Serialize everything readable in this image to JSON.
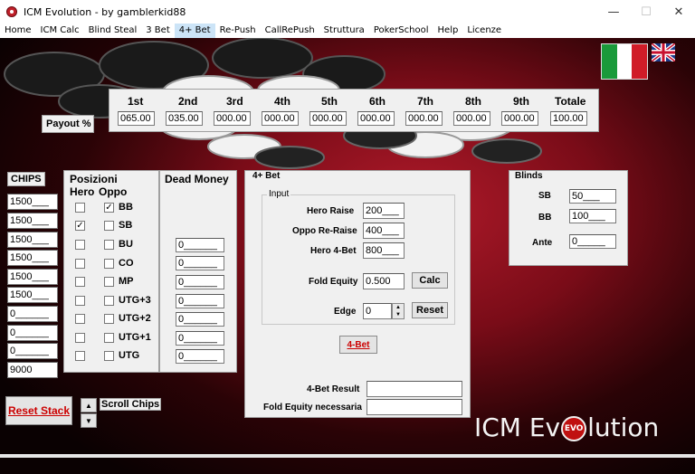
{
  "window": {
    "title": "ICM Evolution - by gamblerkid88",
    "minimize": "—",
    "maximize": "☐",
    "close": "✕"
  },
  "menu": [
    "Home",
    "ICM Calc",
    "Blind Steal",
    "3 Bet",
    "4+ Bet",
    "Re-Push",
    "CallRePush",
    "Struttura",
    "PokerSchool",
    "Help",
    "Licenze"
  ],
  "flags": {
    "italian": "italian-flag-icon",
    "english": "uk-flag-icon"
  },
  "payout": {
    "label": "Payout %",
    "headers": [
      "1st",
      "2nd",
      "3rd",
      "4th",
      "5th",
      "6th",
      "7th",
      "8th",
      "9th",
      "Totale"
    ],
    "values": [
      "065.00",
      "035.00",
      "000.00",
      "000.00",
      "000.00",
      "000.00",
      "000.00",
      "000.00",
      "000.00",
      "100.00"
    ]
  },
  "chips": {
    "label": "CHIPS",
    "values": [
      "1500___",
      "1500___",
      "1500___",
      "1500___",
      "1500___",
      "1500___",
      "0______",
      "0______",
      "0______"
    ],
    "total": "9000"
  },
  "positions": {
    "title_line1": "Posizioni",
    "hero": "Hero",
    "oppo": "Oppo",
    "rows": [
      {
        "label": "BB",
        "hero": "",
        "oppo": "✓"
      },
      {
        "label": "SB",
        "hero": "✓",
        "oppo": ""
      },
      {
        "label": "BU",
        "hero": "",
        "oppo": ""
      },
      {
        "label": "CO",
        "hero": "",
        "oppo": ""
      },
      {
        "label": "MP",
        "hero": "",
        "oppo": ""
      },
      {
        "label": "UTG+3",
        "hero": "",
        "oppo": ""
      },
      {
        "label": "UTG+2",
        "hero": "",
        "oppo": ""
      },
      {
        "label": "UTG+1",
        "hero": "",
        "oppo": ""
      },
      {
        "label": "UTG",
        "hero": "",
        "oppo": ""
      }
    ]
  },
  "dead_money": {
    "title": "Dead Money",
    "values": [
      "0______",
      "0______",
      "0______",
      "0______",
      "0______",
      "0______",
      "0______"
    ]
  },
  "four_bet": {
    "title": "4+ Bet",
    "input_title": "Input",
    "hero_raise_label": "Hero Raise",
    "hero_raise": "200___",
    "oppo_reraise_label": "Oppo Re-Raise",
    "oppo_reraise": "400___",
    "hero_4bet_label": "Hero 4-Bet",
    "hero_4bet": "800___",
    "fold_equity_label": "Fold Equity",
    "fold_equity": "0.500",
    "calc": "Calc",
    "edge_label": "Edge",
    "edge": "0",
    "reset": "Reset",
    "run": "4-Bet",
    "result_label": "4-Bet Result",
    "result": "",
    "fold_needed_label": "Fold Equity necessaria",
    "fold_needed": ""
  },
  "blinds": {
    "title": "Blinds",
    "sb_label": "SB",
    "sb": "50___",
    "bb_label": "BB",
    "bb": "100___",
    "ante_label": "Ante",
    "ante": "0_____"
  },
  "reset_stack": "Reset Stack",
  "scroll_chips": "Scroll Chips",
  "logo": {
    "left": "ICM Ev",
    "badge": "EVO",
    "right": "lution"
  }
}
